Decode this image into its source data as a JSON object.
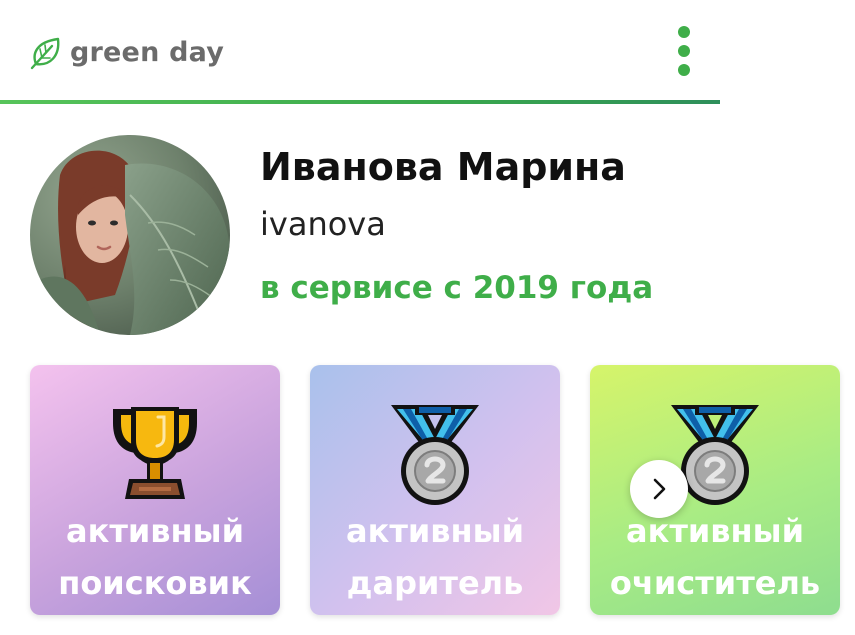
{
  "header": {
    "brand_icon": "leaf-icon",
    "brand_name": "green day",
    "menu_icon": "kebab-menu-icon",
    "accent_color": "#3fae49"
  },
  "profile": {
    "avatar": "profile-photo",
    "full_name": "Иванова Марина",
    "login": "ivanova",
    "member_since": "в сервисе с 2019 года"
  },
  "achievements": [
    {
      "icon": "trophy-icon",
      "line1": "активный",
      "line2": "поисковик"
    },
    {
      "icon": "silver-medal-icon",
      "line1": "активный",
      "line2": "даритель"
    },
    {
      "icon": "silver-medal-icon",
      "line1": "активный",
      "line2": "очиститель"
    }
  ],
  "carousel": {
    "next_icon": "chevron-right-icon"
  }
}
